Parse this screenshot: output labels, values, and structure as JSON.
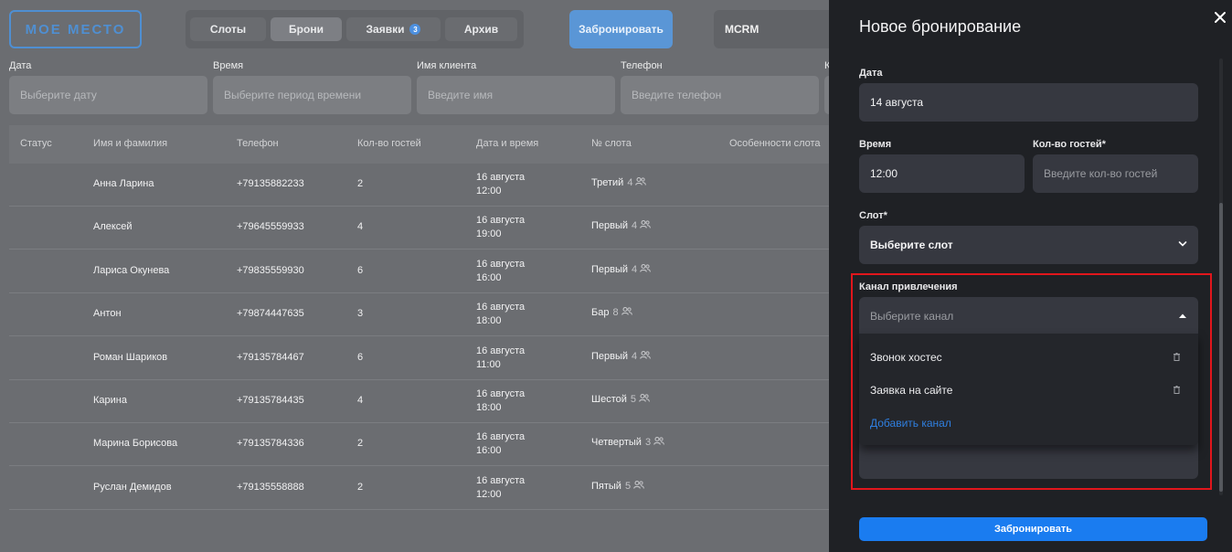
{
  "header": {
    "logo": "МОЕ МЕСТО",
    "tabs": [
      {
        "label": "Слоты"
      },
      {
        "label": "Брони"
      },
      {
        "label": "Заявки",
        "badge": "3"
      },
      {
        "label": "Архив"
      }
    ],
    "book_button": "Забронировать",
    "mcrm": "MCRM"
  },
  "filters": [
    {
      "label": "Дата",
      "placeholder": "Выберите дату"
    },
    {
      "label": "Время",
      "placeholder": "Выберите период времени"
    },
    {
      "label": "Имя клиента",
      "placeholder": "Введите имя"
    },
    {
      "label": "Телефон",
      "placeholder": "Введите телефон"
    },
    {
      "label": "К",
      "placeholder": ""
    }
  ],
  "table": {
    "columns": [
      "Статус",
      "Имя и фамилия",
      "Телефон",
      "Кол-во гостей",
      "Дата и время",
      "№ слота",
      "Особенности слота"
    ],
    "rows": [
      {
        "name": "Анна Ларина",
        "phone": "+79135882233",
        "guests": "2",
        "date": "16 августа",
        "time": "12:00",
        "slot": "Третий",
        "cap": "4"
      },
      {
        "name": "Алексей",
        "phone": "+79645559933",
        "guests": "4",
        "date": "16 августа",
        "time": "19:00",
        "slot": "Первый",
        "cap": "4"
      },
      {
        "name": "Лариса Окунева",
        "phone": "+79835559930",
        "guests": "6",
        "date": "16 августа",
        "time": "16:00",
        "slot": "Первый",
        "cap": "4"
      },
      {
        "name": "Антон",
        "phone": "+79874447635",
        "guests": "3",
        "date": "16 августа",
        "time": "18:00",
        "slot": "Бар",
        "cap": "8"
      },
      {
        "name": "Роман Шариков",
        "phone": "+79135784467",
        "guests": "6",
        "date": "16 августа",
        "time": "11:00",
        "slot": "Первый",
        "cap": "4"
      },
      {
        "name": "Карина",
        "phone": "+79135784435",
        "guests": "4",
        "date": "16 августа",
        "time": "18:00",
        "slot": "Шестой",
        "cap": "5"
      },
      {
        "name": "Марина Борисова",
        "phone": "+79135784336",
        "guests": "2",
        "date": "16 августа",
        "time": "16:00",
        "slot": "Четвертый",
        "cap": "3"
      },
      {
        "name": "Руслан Демидов",
        "phone": "+79135558888",
        "guests": "2",
        "date": "16 августа",
        "time": "12:00",
        "slot": "Пятый",
        "cap": "5"
      }
    ]
  },
  "panel": {
    "title": "Новое бронирование",
    "date_label": "Дата",
    "date_value": "14 августа",
    "time_label": "Время",
    "time_value": "12:00",
    "guests_label": "Кол-во гостей*",
    "guests_placeholder": "Введите кол-во гостей",
    "slot_label": "Слот*",
    "slot_value": "Выберите слот",
    "channel_label": "Канал привлечения",
    "channel_placeholder": "Выберите канал",
    "channel_options": [
      "Звонок хостес",
      "Заявка на сайте"
    ],
    "add_channel": "Добавить канал",
    "submit": "Забронировать"
  },
  "colors": {
    "accent": "#1a7cf0",
    "highlight": "#e1161c",
    "panel_bg": "#1f2125"
  }
}
